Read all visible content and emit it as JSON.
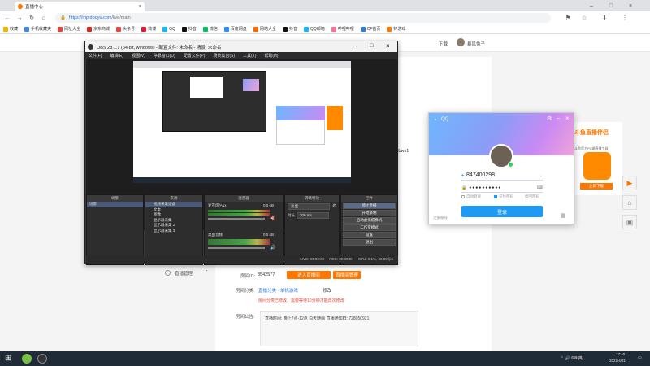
{
  "browser": {
    "tab_title": "直播中心",
    "url_host": "https://mp.douyu.com",
    "url_path": "/live/main",
    "bookmarks": [
      "收藏",
      "手机收藏夹",
      "网址大全",
      "京东商城",
      "头条号",
      "微博",
      "QQ",
      "抖音",
      "微信",
      "百度网盘",
      "网站大全",
      "抖音",
      "QQ邮箱",
      "哔哩哔哩",
      "CF首页",
      "好游戏"
    ]
  },
  "site": {
    "download": "下载",
    "user": "暴风兔子"
  },
  "main": {
    "room_id_label": "房间ID:",
    "room_id": "8542577",
    "enter_room_btn": "进入直播间",
    "manage_room_btn": "直播间管理",
    "category_label": "房间分类:",
    "category_link": "直播分类 · 单机游戏",
    "modify": "修改",
    "category_notice": "房间分类已修改，需要等待10分钟才能再次修改",
    "announce_label": "房间公告:",
    "announce_text": "直播时间: 晚上7点-12点 白天随缘 直播通知群: 728050921",
    "side_item": "直播管理",
    "stream_key_fragment": "**lbws1"
  },
  "obs": {
    "title": "OBS 28.1.1 (64-bit, windows) - 配置文件: 未命名 - 场景: 未命名",
    "menu": [
      "文件(F)",
      "编辑(E)",
      "视图(V)",
      "停靠窗口(D)",
      "配置文件(P)",
      "场景集合(S)",
      "工具(T)",
      "帮助(H)"
    ],
    "no_source": "未选择源",
    "props": "属性",
    "filters": "滤镜",
    "docks": {
      "scenes": "场景",
      "sources": "来源",
      "mixer": "混音器",
      "transitions": "转场特效",
      "controls": "控件"
    },
    "scene_items": [
      "场景"
    ],
    "source_items": [
      "视频采集设备",
      "文本",
      "图像",
      "显示器采集",
      "显示器采集 2",
      "显示器采集 3"
    ],
    "mixer": {
      "track1": "麦克风/Aux",
      "track1_db": "0.0 dB",
      "track2": "桌面音频",
      "track2_db": "0.0 dB"
    },
    "transition": {
      "type": "淡出",
      "duration_label": "时长",
      "duration": "300 ms"
    },
    "controls": [
      "停止直播",
      "开始录制",
      "启动虚拟摄像机",
      "工作室模式",
      "设置",
      "退出"
    ],
    "status": [
      "LIVE: 00:00:00",
      "REC: 00:00:00",
      "CPU: 5.1%, 60.00 fps"
    ]
  },
  "qq": {
    "brand": "QQ",
    "account": "847400298",
    "password_mask": "●●●●●●●●●●",
    "auto_login": "自动登录",
    "remember_pwd": "记住密码",
    "forgot_pwd": "找回密码",
    "login_btn": "登录",
    "register": "注册账号"
  },
  "ad": {
    "title": "斗鱼直播伴侣",
    "sub": "斗鱼官方PC端直播工具",
    "btn": "立即下载"
  },
  "taskbar": {
    "time": "17:40",
    "date": "2022/4/21"
  },
  "colors": {
    "accent_orange": "#ff7700",
    "qq_blue": "#1e9af5",
    "obs_bg": "#2d2d2d"
  }
}
